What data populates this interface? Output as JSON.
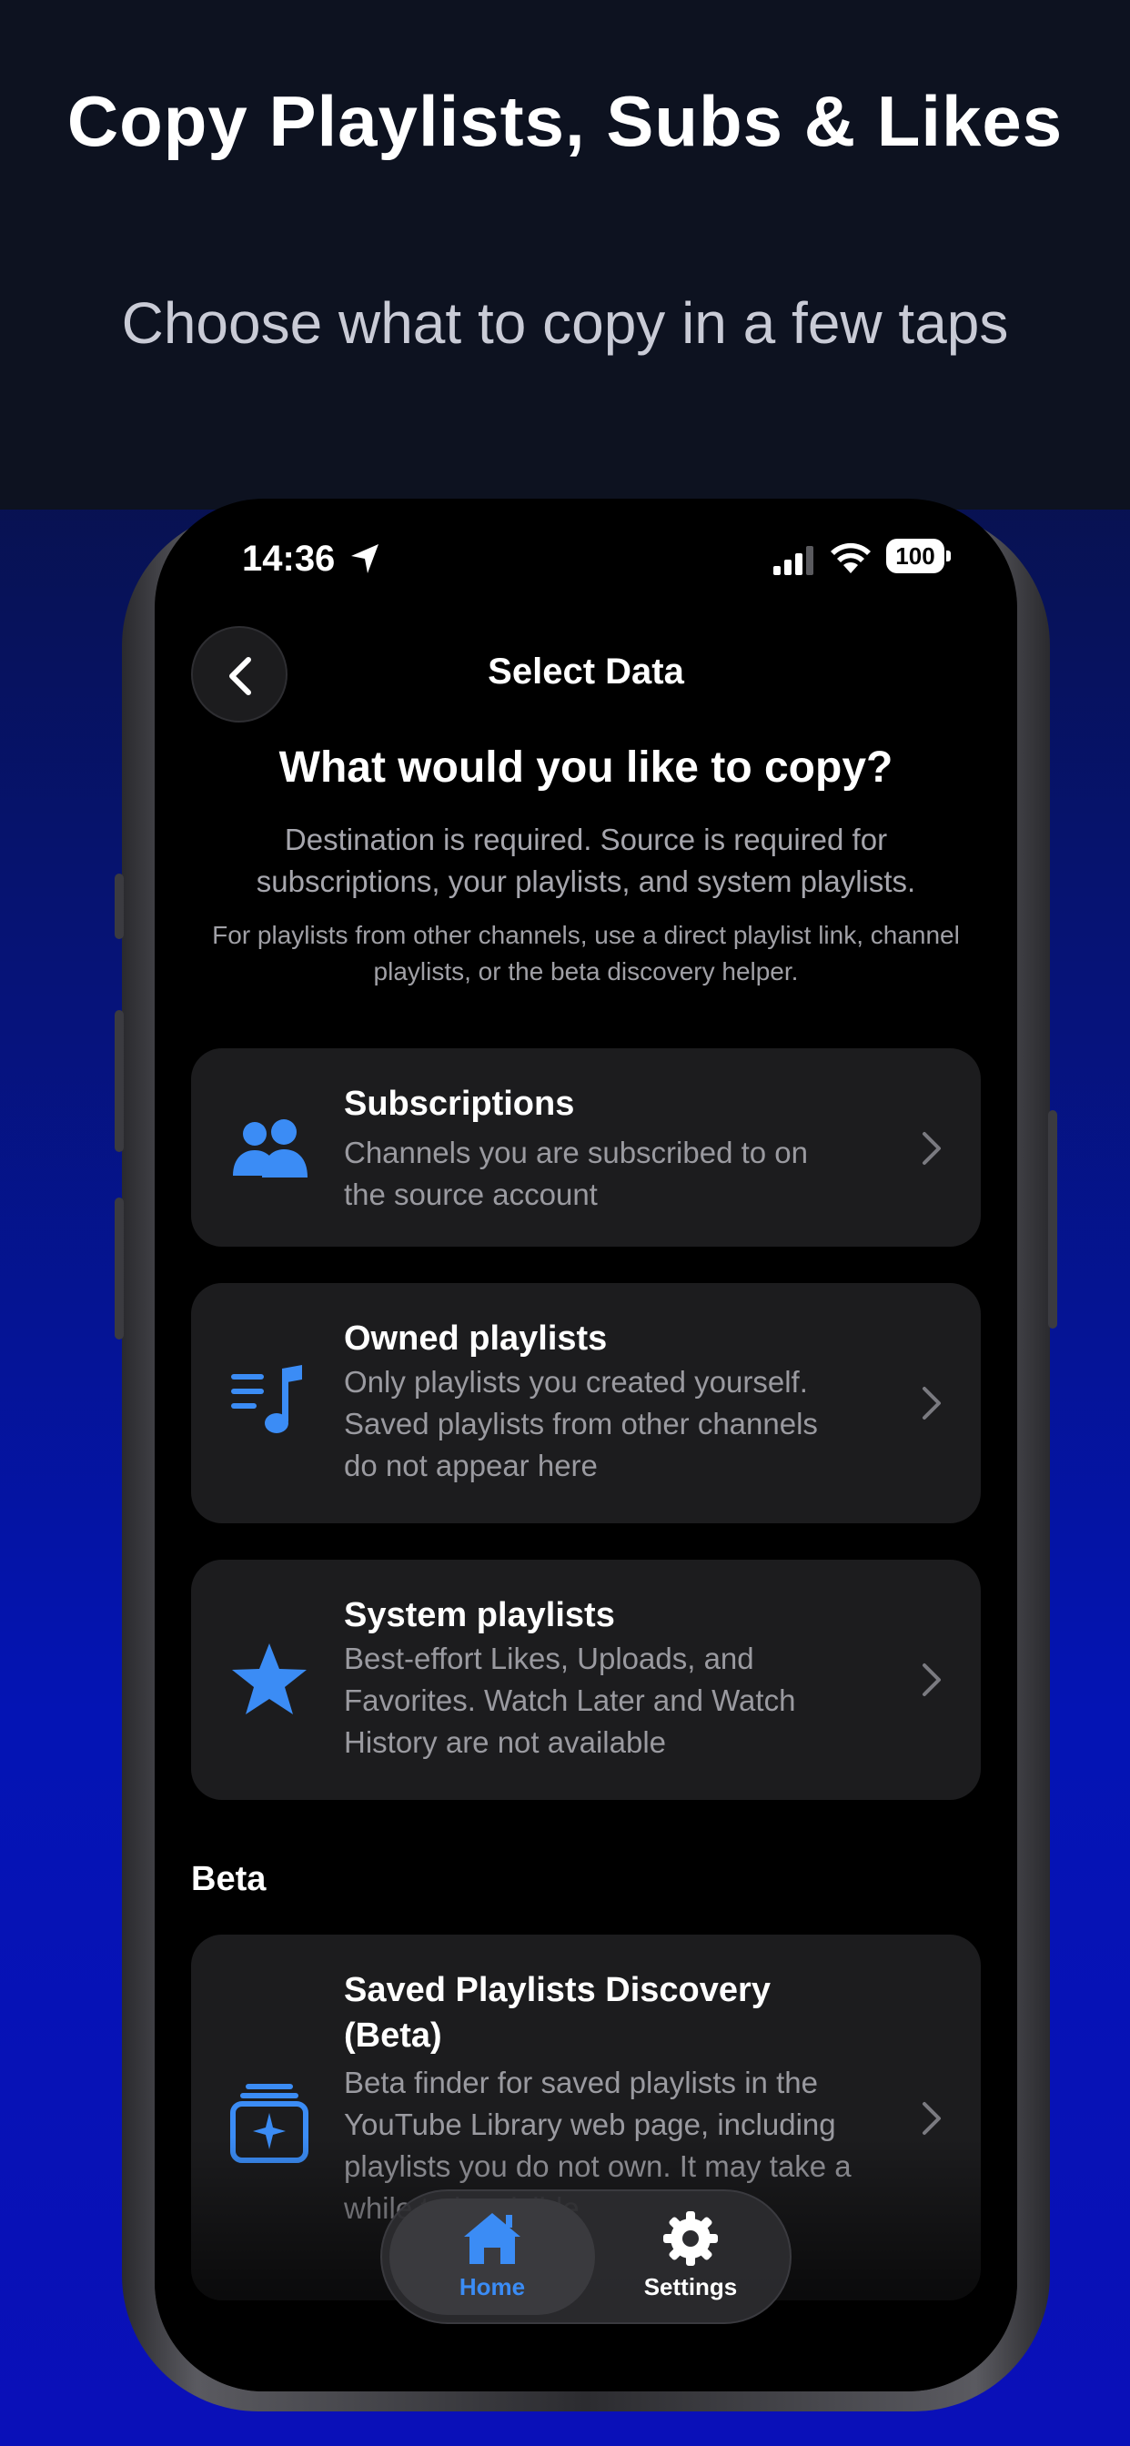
{
  "promo": {
    "headline": "Copy Playlists, Subs & Likes",
    "subline": "Choose what to copy in a few taps"
  },
  "status_bar": {
    "time": "14:36",
    "battery": "100"
  },
  "nav": {
    "title": "Select Data"
  },
  "intro": {
    "question": "What would you like to copy?",
    "description": "Destination is required. Source is required for subscriptions, your playlists, and system playlists.",
    "note": "For playlists from other channels, use a direct playlist link, channel playlists, or the beta discovery helper."
  },
  "options": [
    {
      "title": "Subscriptions",
      "body": "Channels you are subscribed to on the source account",
      "icon": "people-icon"
    },
    {
      "title": "Owned playlists",
      "body": "Only playlists you created yourself. Saved playlists from other channels do not appear here",
      "icon": "music-list-icon"
    },
    {
      "title": "System playlists",
      "body": "Best-effort Likes, Uploads, and Favorites. Watch Later and Watch History are not available",
      "icon": "star-icon"
    }
  ],
  "beta": {
    "section_label": "Beta",
    "title": "Saved Playlists Discovery (Beta)",
    "body": "Beta finder for saved playlists in the YouTube Library web page, including playlists you do not own. It may take a while to be visible",
    "icon": "sparkle-stack-icon"
  },
  "tabs": [
    {
      "label": "Home",
      "icon": "house-icon",
      "selected": true
    },
    {
      "label": "Settings",
      "icon": "gear-icon",
      "selected": false
    }
  ],
  "colors": {
    "accent": "#3b8cf5",
    "card": "#1c1c1e",
    "background_top": "#0d1220",
    "background_gradient_end": "#0a10b8"
  }
}
